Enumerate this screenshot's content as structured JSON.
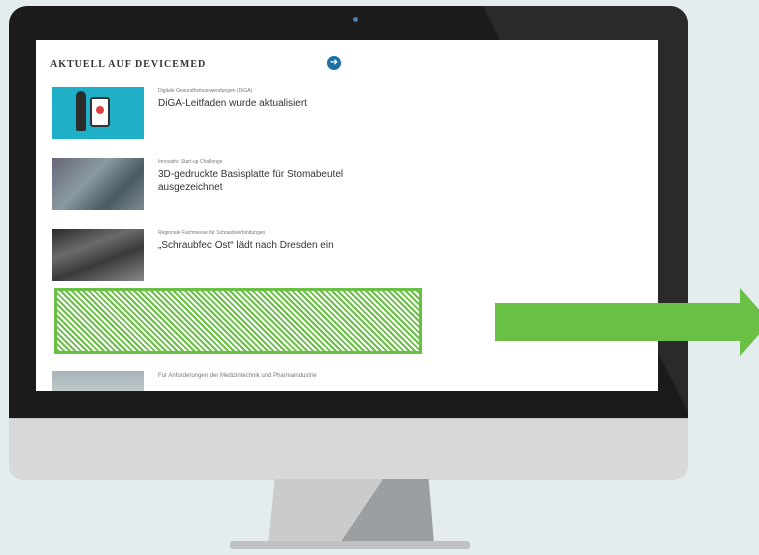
{
  "section": {
    "title": "AKTUELL AUF DEVICEMED"
  },
  "nav": {
    "next_glyph": "➜"
  },
  "news": [
    {
      "kicker": "Digitale Gesundheitsanwendungen (DiGA)",
      "headline": "DiGA-Leitfaden wurde aktualisiert"
    },
    {
      "kicker": "Innovativ: Start-up Challenge",
      "headline": "3D-gedruckte Basisplatte für Stomabeutel ausgezeichnet"
    },
    {
      "kicker": "Regionale Fachmesse für Schraubverbindungen",
      "headline": "„Schraubfec Ost“ lädt nach Dresden ein"
    },
    {
      "kicker": "",
      "headline": "Für Anforderungen der Medizintechnik und Pharmaindustrie"
    }
  ],
  "colors": {
    "accent_green": "#6abf45",
    "nav_blue": "#1e6fa3"
  }
}
